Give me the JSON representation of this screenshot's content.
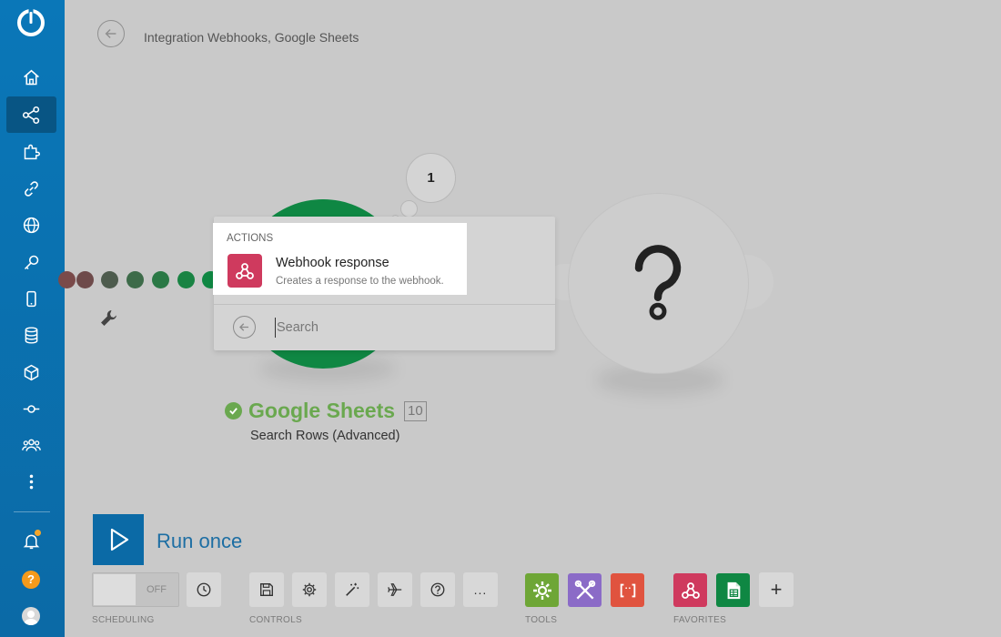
{
  "header": {
    "title": "Integration Webhooks, Google Sheets"
  },
  "scenario": {
    "bubble_count": "1",
    "google_sheets": {
      "name": "Google Sheets",
      "id": "10",
      "subtitle": "Search Rows (Advanced)"
    }
  },
  "popup": {
    "section_label": "ACTIONS",
    "item": {
      "title": "Webhook response",
      "description": "Creates a response to the webhook."
    },
    "search_placeholder": "Search"
  },
  "bottom": {
    "run_label": "Run once",
    "scheduling_label": "SCHEDULING",
    "scheduling_state": "OFF",
    "controls_label": "CONTROLS",
    "tools_label": "TOOLS",
    "favorites_label": "FAVORITES",
    "more_label": "...",
    "add_label": "+"
  },
  "sidebar": {
    "help_glyph": "?"
  },
  "colors": {
    "sidebar": "#0b6aa6",
    "google_green": "#0f8743",
    "webhook_pink": "#cf3a5e",
    "tools_green": "#6ea636",
    "tools_purple": "#8b6bc7",
    "tools_red": "#e0533f"
  }
}
